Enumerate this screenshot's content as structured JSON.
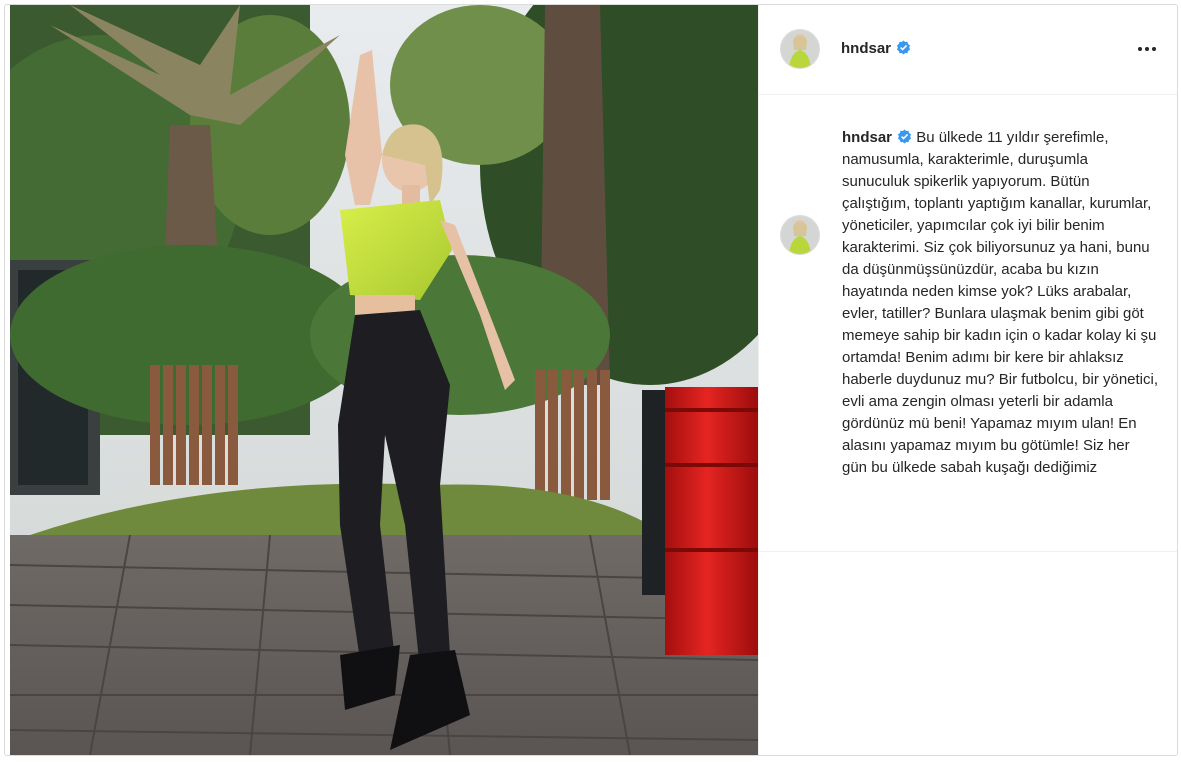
{
  "header": {
    "username": "hndsar",
    "verified_icon": "verified-badge-icon",
    "more_icon": "more-options-icon"
  },
  "caption": {
    "username": "hndsar",
    "text": "Bu ülkede 11 yıldır şerefimle, namusumla, karakterimle, duruşumla sunuculuk spikerlik yapıyorum. Bütün çalıştığım, toplantı yaptığım kanallar, kurumlar, yöneticiler, yapımcılar çok iyi bilir benim karakterimi. Siz çok biliyorsunuz ya hani, bunu da düşünmüşsünüzdür, acaba bu kızın hayatında neden kimse yok? Lüks arabalar, evler, tatiller? Bunlara ulaşmak benim gibi göt memeye sahip bir kadın için o kadar kolay ki şu ortamda! Benim adımı bir kere bir ahlaksız haberle duydunuz mu? Bir futbolcu, bir yönetici, evli ama zengin olması yeterli bir adamla gördünüz mü beni! Yapamaz mıyım ulan! En alasını yapamaz mıyım bu götümle! Siz her gün bu ülkede sabah kuşağı dediğimiz"
  },
  "colors": {
    "verified_blue": "#3897f0",
    "text": "#262626",
    "border": "#dbdbdb",
    "barrel_red": "#d81a18",
    "top_green": "#c6e23c"
  }
}
